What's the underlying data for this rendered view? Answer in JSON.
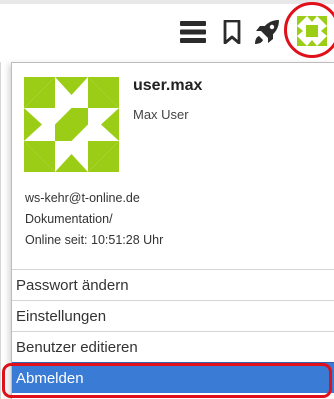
{
  "toolbar": {
    "icons": [
      "menu-icon",
      "bookmark-icon",
      "rocket-icon",
      "user-avatar-icon"
    ]
  },
  "user": {
    "username": "user.max",
    "full_name": "Max User",
    "email": "ws-kehr@t-online.de",
    "path": "Dokumentation/",
    "online_since": "Online seit: 10:51:28 Uhr"
  },
  "menu": {
    "items": [
      {
        "label": "Passwort ändern"
      },
      {
        "label": "Einstellungen"
      },
      {
        "label": "Benutzer editieren"
      },
      {
        "label": "Abmelden"
      }
    ]
  },
  "colors": {
    "avatar_green": "#9ccd16",
    "highlight_red": "#e0101a",
    "active_blue": "#3a7bd5"
  }
}
